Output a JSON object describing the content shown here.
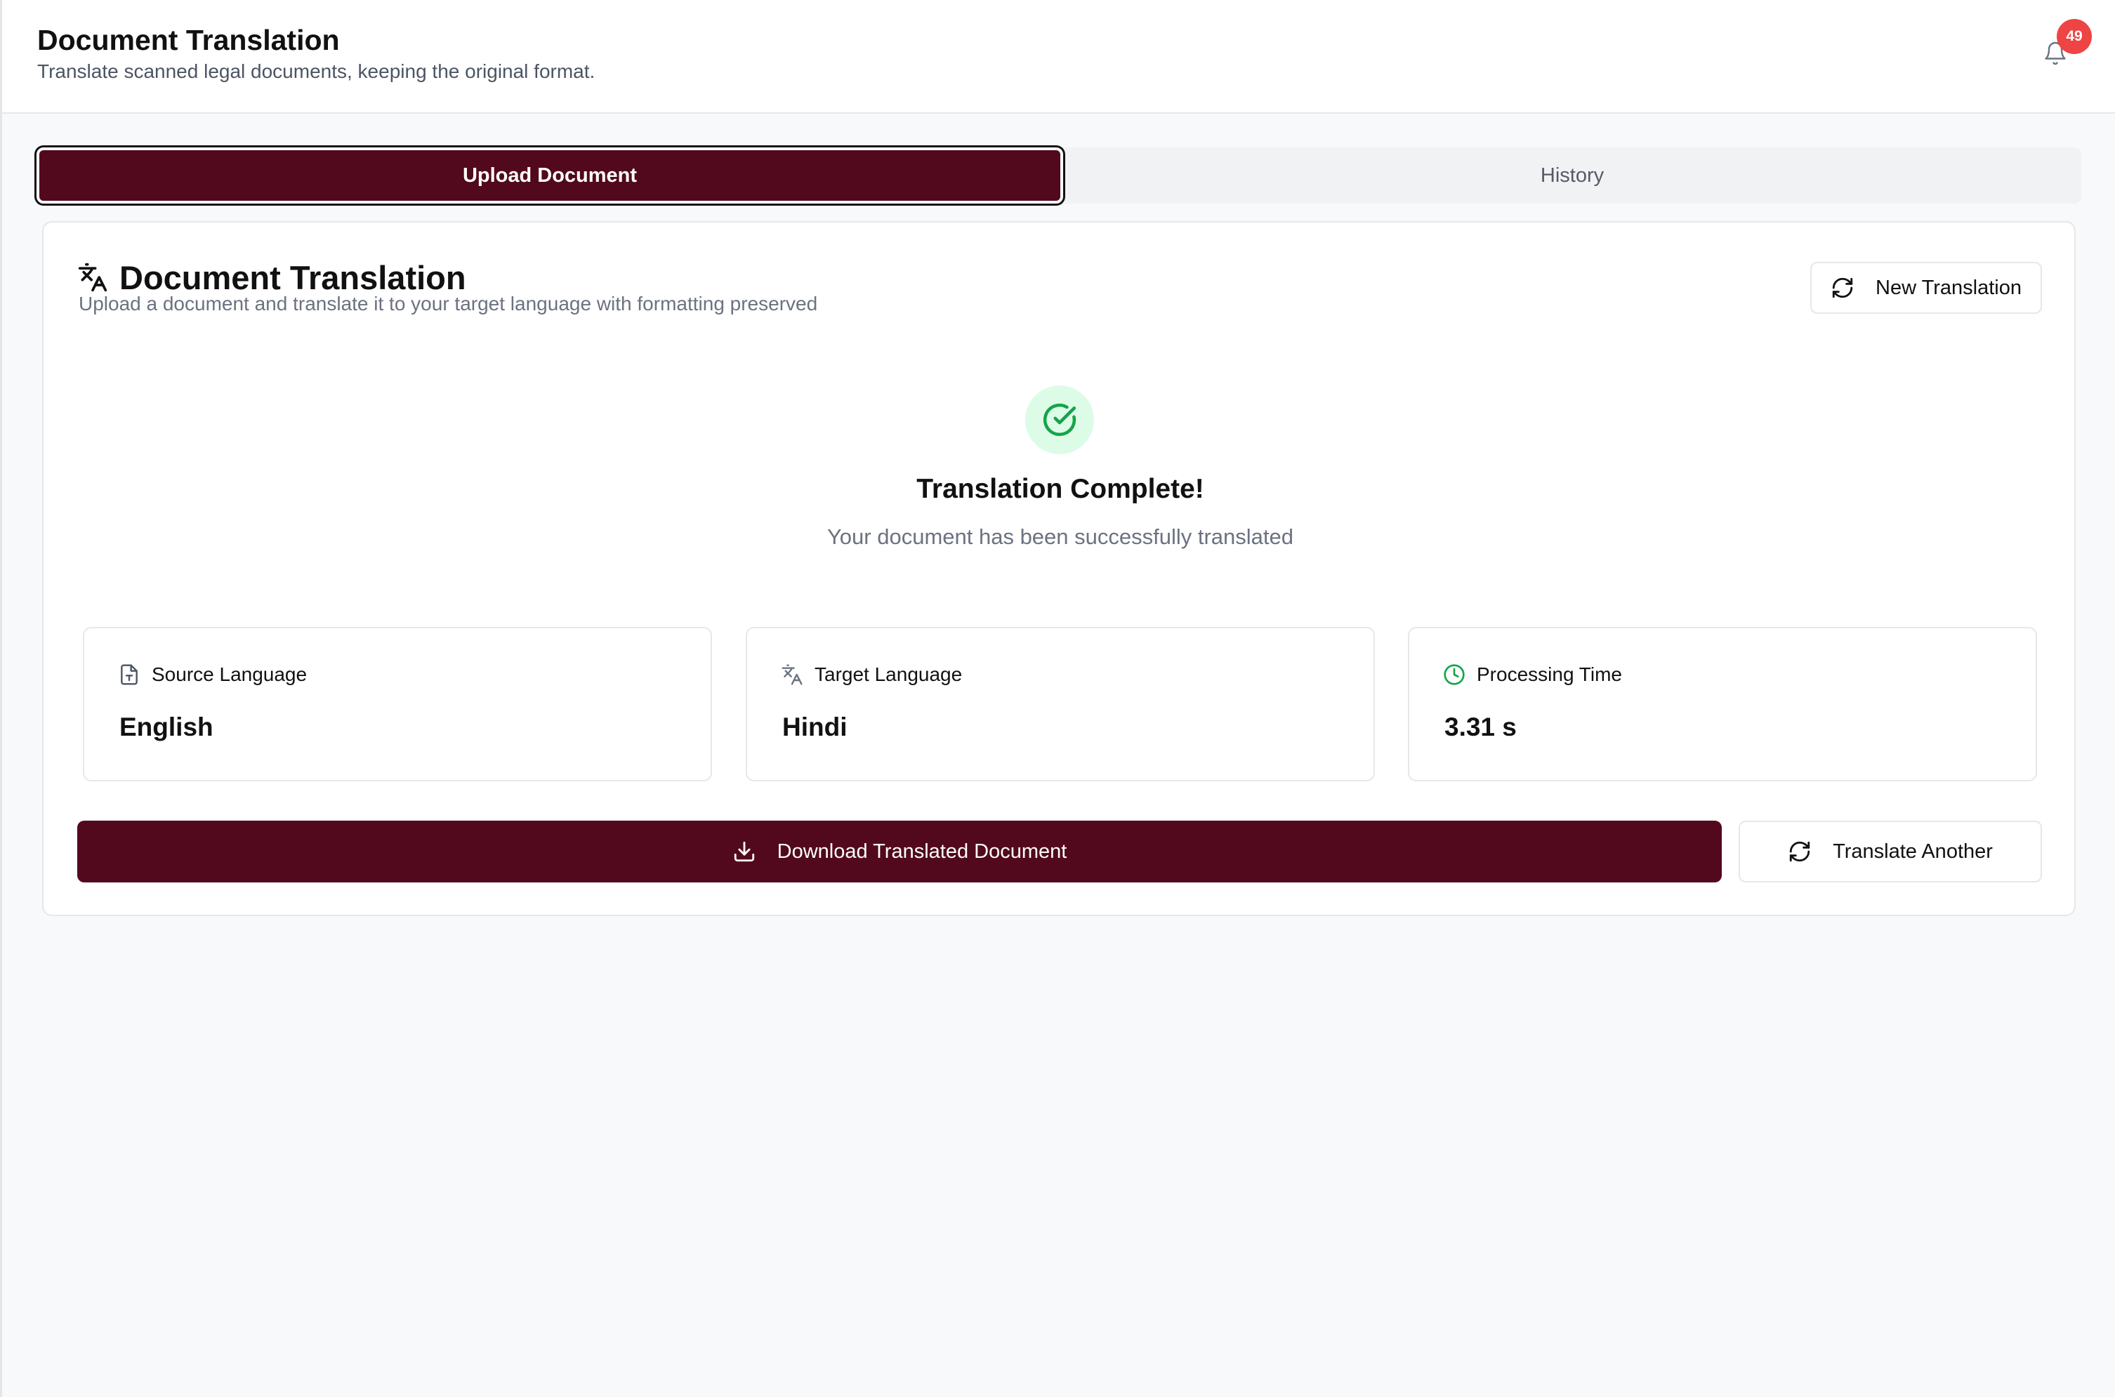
{
  "header": {
    "title": "Document Translation",
    "subtitle": "Translate scanned legal documents, keeping the original format.",
    "notification_count": "49",
    "notification_icon": "bell-icon"
  },
  "tabs": [
    {
      "label": "Upload Document",
      "active": true
    },
    {
      "label": "History",
      "active": false
    }
  ],
  "card": {
    "title": "Document Translation",
    "title_icon": "translate-icon",
    "description": "Upload a document and translate it to your target language with formatting preserved",
    "new_translation_label": "New Translation"
  },
  "result": {
    "heading": "Translation Complete!",
    "message": "Your document has been successfully translated",
    "status_icon": "check-circle-icon",
    "stats": [
      {
        "label": "Source Language",
        "value": "English",
        "icon": "file-icon"
      },
      {
        "label": "Target Language",
        "value": "Hindi",
        "icon": "translate-icon"
      },
      {
        "label": "Processing Time",
        "value": "3.31 s",
        "icon": "clock-icon"
      }
    ],
    "download_label": "Download Translated Document",
    "translate_another_label": "Translate Another"
  },
  "colors": {
    "brand": "#52091d",
    "success": "#16a34a",
    "success_bg": "#dcfce7",
    "badge": "#ef4444"
  }
}
